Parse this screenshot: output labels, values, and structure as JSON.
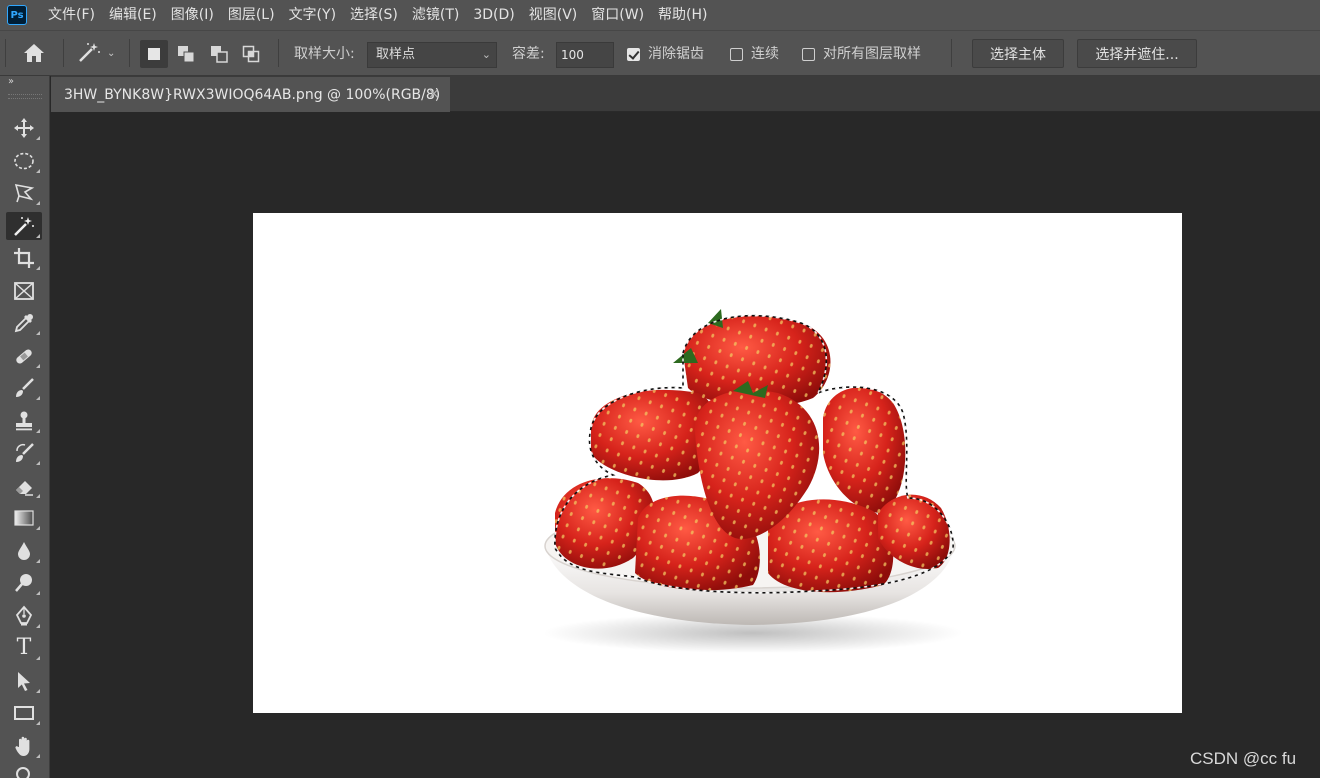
{
  "app": {
    "logo_text": "Ps"
  },
  "menu": [
    "文件(F)",
    "编辑(E)",
    "图像(I)",
    "图层(L)",
    "文字(Y)",
    "选择(S)",
    "滤镜(T)",
    "3D(D)",
    "视图(V)",
    "窗口(W)",
    "帮助(H)"
  ],
  "options": {
    "sample_size_label": "取样大小:",
    "sample_size_value": "取样点",
    "tolerance_label": "容差:",
    "tolerance_value": "100",
    "antialias_label": "消除锯齿",
    "antialias_checked": true,
    "contiguous_label": "连续",
    "contiguous_checked": false,
    "sample_all_layers_label": "对所有图层取样",
    "sample_all_layers_checked": false,
    "select_subject_label": "选择主体",
    "select_and_mask_label": "选择并遮住..."
  },
  "toolbar": {
    "collapse_glyph": "››",
    "tools": [
      "move-tool",
      "elliptical-marquee-tool",
      "polygonal-lasso-tool",
      "magic-wand-tool",
      "crop-tool",
      "frame-tool",
      "eyedropper-tool",
      "spot-healing-brush-tool",
      "brush-tool",
      "clone-stamp-tool",
      "history-brush-tool",
      "eraser-tool",
      "gradient-tool",
      "blur-tool",
      "dodge-tool",
      "pen-tool",
      "type-tool",
      "path-selection-tool",
      "rectangle-tool",
      "hand-tool",
      "zoom-tool"
    ],
    "active_tool": "magic-wand-tool",
    "type_tool_glyph": "T"
  },
  "document": {
    "tab_title": "3HW_BYNK8W}RWX3WIOQ64AB.png @ 100%(RGB/8)",
    "close_glyph": "×"
  },
  "watermark": "CSDN @cc fu",
  "colors": {
    "ui_panel": "#535353",
    "canvas_bg": "#282828",
    "accent_ps": "#31a8ff",
    "strawberry": "#d6231b"
  }
}
